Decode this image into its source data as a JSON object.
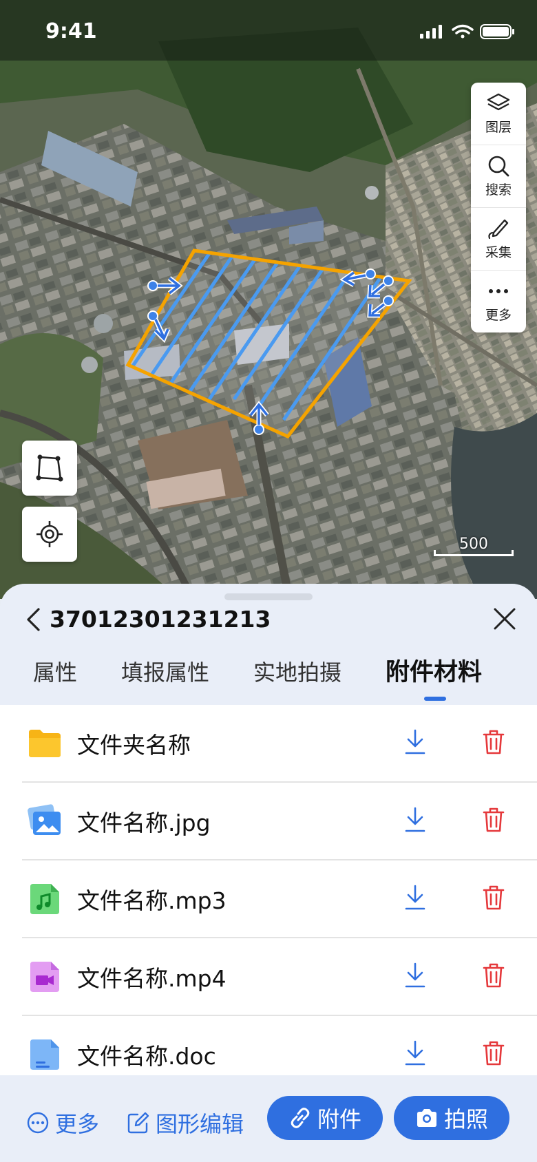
{
  "status_bar": {
    "time": "9:41"
  },
  "map": {
    "tools": [
      {
        "icon": "layers-icon",
        "label": "图层"
      },
      {
        "icon": "search-icon",
        "label": "搜索"
      },
      {
        "icon": "pen-icon",
        "label": "采集"
      },
      {
        "icon": "more-dots-icon",
        "label": "更多"
      }
    ],
    "scale_label": "500"
  },
  "sheet": {
    "parcel_id": "37012301231213",
    "tabs": [
      {
        "label": "属性",
        "active": false
      },
      {
        "label": "填报属性",
        "active": false
      },
      {
        "label": "实地拍摄",
        "active": false
      },
      {
        "label": "附件材料",
        "active": true
      }
    ],
    "files": [
      {
        "name": "文件夹名称",
        "icon": "folder-icon"
      },
      {
        "name": "文件名称.jpg",
        "icon": "image-file-icon"
      },
      {
        "name": "文件名称.mp3",
        "icon": "music-file-icon"
      },
      {
        "name": "文件名称.mp4",
        "icon": "video-file-icon"
      },
      {
        "name": "文件名称.doc",
        "icon": "doc-file-icon"
      }
    ]
  },
  "bottom_bar": {
    "more_label": "更多",
    "edit_label": "图形编辑",
    "attach_label": "附件",
    "photo_label": "拍照"
  },
  "colors": {
    "accent": "#2f6fe0",
    "delete": "#e5383b",
    "polygon_outline": "#f5a300",
    "hatch": "#4a9af0"
  }
}
